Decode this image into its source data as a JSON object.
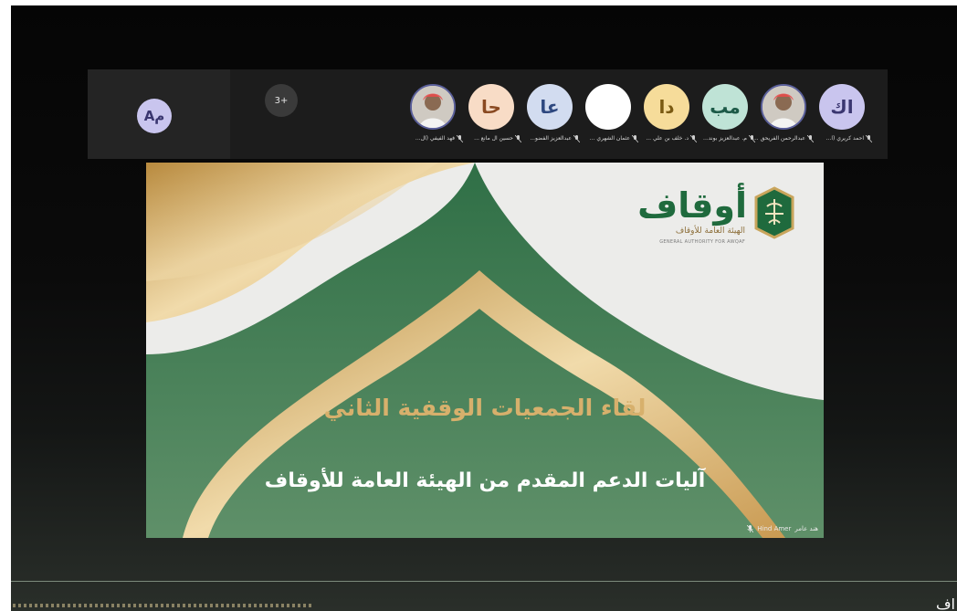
{
  "meeting": {
    "self_initials": "Aم",
    "overflow_count": "3+",
    "participants": [
      {
        "initials": "اك",
        "name": "احمد كريري (ا...",
        "avatar_bg": "#c9c5ee",
        "avatar_fg": "#3a3670",
        "photo": false
      },
      {
        "initials": "",
        "name": "عبدالرحمن الفريحق ...",
        "avatar_bg": "#d9d5cf",
        "avatar_fg": "#333333",
        "photo": true
      },
      {
        "initials": "مب",
        "name": "م. عبدالعزيز بوند...",
        "avatar_bg": "#bfe3d6",
        "avatar_fg": "#1d5a48",
        "photo": false
      },
      {
        "initials": "دا",
        "name": "د. خلف بن علي ...",
        "avatar_bg": "#f6dc9a",
        "avatar_fg": "#7a5a12",
        "photo": false
      },
      {
        "initials": "",
        "name": "عثمان الشهري ...",
        "avatar_bg": "#ffffff",
        "avatar_fg": "#333333",
        "photo": false
      },
      {
        "initials": "عا",
        "name": "عبدالعزيز الفضو...",
        "avatar_bg": "#d2dcf0",
        "avatar_fg": "#2e4880",
        "photo": false
      },
      {
        "initials": "حا",
        "name": "حسين آل مانع ...",
        "avatar_bg": "#f8dcc6",
        "avatar_fg": "#8a4a22",
        "photo": false
      },
      {
        "initials": "",
        "name": "فهد الفيفي (ال...",
        "avatar_bg": "#d9d5cf",
        "avatar_fg": "#333333",
        "photo": true
      }
    ]
  },
  "slide": {
    "logo_word": "أوقاف",
    "logo_sub": "الهيئة العامة للأوقاف",
    "logo_en": "GENERAL AUTHORITY FOR AWQAF",
    "title": "لقاء الجمعيات الوقفية الثاني",
    "subtitle": "آليات الدعم المقدم من الهيئة العامة للأوقاف",
    "presenter_name": "Hind Amer",
    "presenter_name_ar": "هند عامر"
  },
  "bottom": {
    "partial_text": "اف"
  },
  "colors": {
    "green": "#2d6a45",
    "gold": "#d7b06c",
    "strip": "#1c1c1c"
  }
}
